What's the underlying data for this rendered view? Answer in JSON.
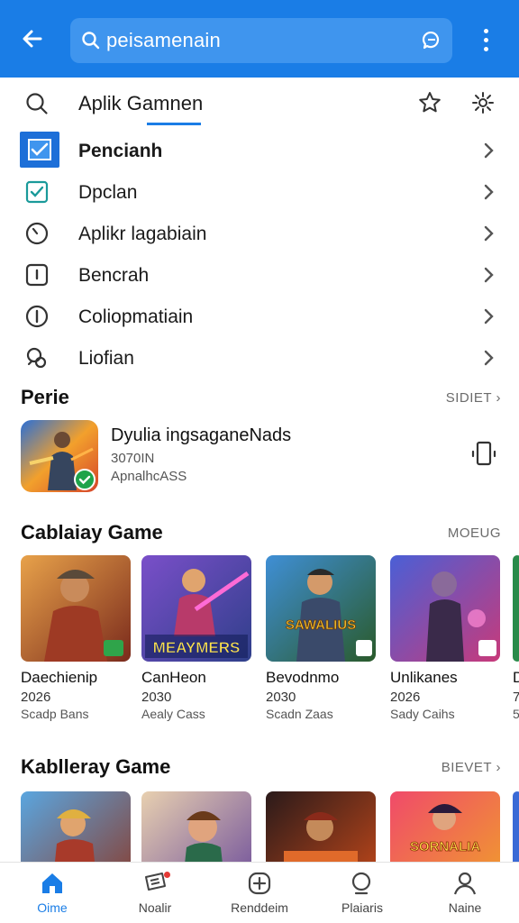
{
  "appbar": {
    "search_text": "peisamenain",
    "icons": [
      "back-arrow-icon",
      "search-icon",
      "chat-icon",
      "more-vert-icon"
    ]
  },
  "menu": {
    "header_label": "Aplik Gamnen",
    "items": [
      {
        "label": "Pencianh",
        "icon": "checkbox-checked-icon",
        "selected": true
      },
      {
        "label": "Dpclan",
        "icon": "checkbox-outline-icon",
        "selected": false
      },
      {
        "label": "Aplikr lagabiain",
        "icon": "clock-icon",
        "selected": false
      },
      {
        "label": "Bencrah",
        "icon": "square-info-icon",
        "selected": false
      },
      {
        "label": "Coliopmatiain",
        "icon": "info-circle-icon",
        "selected": false
      },
      {
        "label": "Liofian",
        "icon": "link-icon",
        "selected": false
      }
    ]
  },
  "featured": {
    "section_title": "Perie",
    "section_link": "SIDIET",
    "app": {
      "title": "Dyulia ingsaganeNads",
      "line1": "3070IN",
      "line2": "ApnalhcASS"
    }
  },
  "section_games": {
    "title": "Cablaiay Game",
    "link": "MOEUG",
    "cards": [
      {
        "name": "Daechienip",
        "year": "2026",
        "meta": "Scadp Bans",
        "art_text": ""
      },
      {
        "name": "CanHeon",
        "year": "2030",
        "meta": "Aealy Cass",
        "art_text": "MEAYMERS"
      },
      {
        "name": "Bevodnmo",
        "year": "2030",
        "meta": "Scadn Zaas",
        "art_text": "SAWALIUS"
      },
      {
        "name": "Unlikanes",
        "year": "2026",
        "meta": "Sady Caihs",
        "art_text": ""
      },
      {
        "name": "D",
        "year": "7",
        "meta": "5",
        "art_text": ""
      }
    ]
  },
  "section_games2": {
    "title": "Kablleray Game",
    "link": "BIEVET",
    "cards": [
      {
        "art_text": ""
      },
      {
        "art_text": ""
      },
      {
        "art_text": ""
      },
      {
        "art_text": "SORNALIA"
      }
    ]
  },
  "bottom_nav": [
    {
      "label": "Oime",
      "icon": "home-icon",
      "active": true
    },
    {
      "label": "Noalir",
      "icon": "ticket-icon",
      "active": false
    },
    {
      "label": "Renddeim",
      "icon": "add-circle-icon",
      "active": false
    },
    {
      "label": "Plaiaris",
      "icon": "search-icon",
      "active": false
    },
    {
      "label": "Naine",
      "icon": "person-icon",
      "active": false
    }
  ],
  "colors": {
    "accent": "#1a7de6",
    "selected_icon_bg": "#1d6fd8",
    "notification_dot": "#e53935"
  }
}
